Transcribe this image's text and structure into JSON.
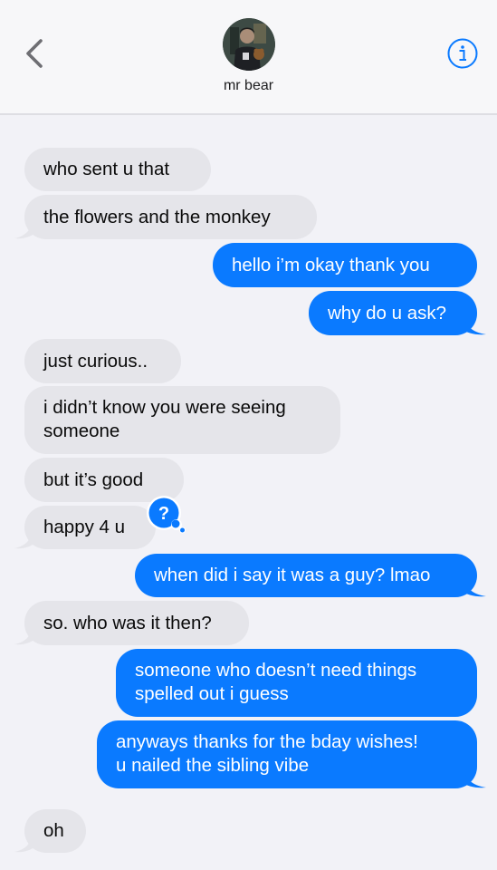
{
  "header": {
    "contact_name": "mr bear",
    "back_icon": "chevron-left-icon",
    "info_icon": "info-circle-icon",
    "accent": "#0a7aff"
  },
  "messages": [
    {
      "from": "them",
      "text": "who sent u that"
    },
    {
      "from": "them",
      "text": "the flowers and the monkey"
    },
    {
      "from": "me",
      "text": "hello i’m okay thank you"
    },
    {
      "from": "me",
      "text": "why do u ask?"
    },
    {
      "from": "them",
      "text": "just curious.."
    },
    {
      "from": "them",
      "lines": [
        "i didn’t know you were seeing",
        "someone"
      ]
    },
    {
      "from": "them",
      "text": "but it’s good"
    },
    {
      "from": "them",
      "text": "happy 4 u",
      "reaction": "?"
    },
    {
      "from": "me",
      "text": "when did i say it was a guy? lmao"
    },
    {
      "from": "them",
      "text": "so. who was it then?"
    },
    {
      "from": "me",
      "lines": [
        "someone who doesn’t need things",
        "spelled out i guess"
      ]
    },
    {
      "from": "me",
      "lines": [
        "anyways thanks for the bday wishes!",
        "u nailed the sibling vibe"
      ]
    },
    {
      "from": "them",
      "text": "oh"
    }
  ],
  "colors": {
    "incoming_bubble": "#e5e5ea",
    "outgoing_bubble": "#0a7aff",
    "background": "#f2f2f7"
  }
}
